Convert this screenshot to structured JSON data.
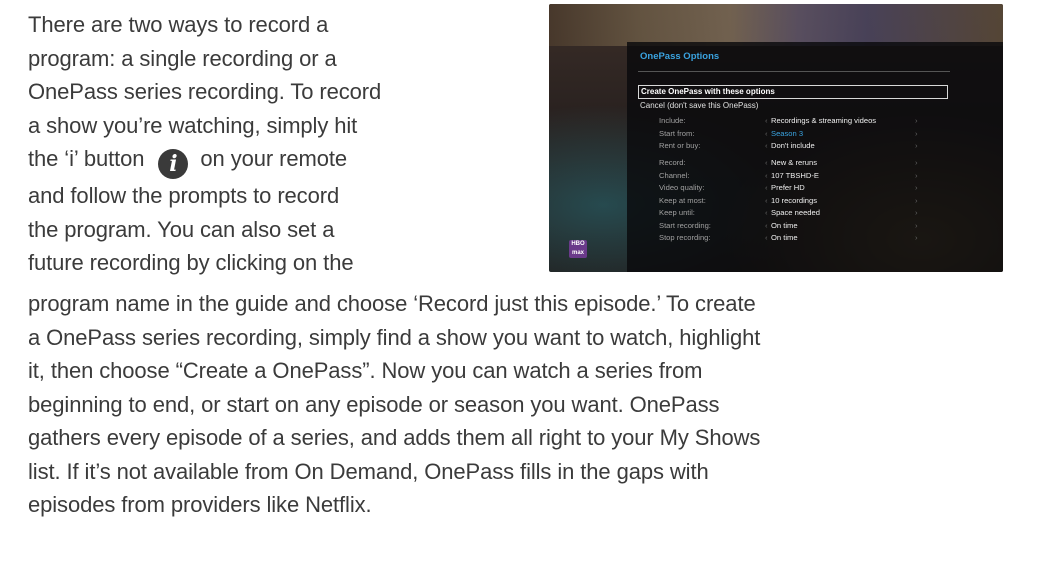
{
  "intro_lines": [
    "There are two ways to record a",
    "program: a single recording or a",
    "OnePass series recording.  To record",
    "a show you’re watching, simply hit"
  ],
  "info_line": {
    "before": "the ‘i’ button",
    "icon_glyph": "i",
    "after": "on your remote"
  },
  "intro_lines_2": [
    "and follow the prompts to record",
    "the program. You can also set a",
    "future recording by clicking on the"
  ],
  "body_lines": [
    "program name in the guide and choose ‘Record just this episode.’ To create",
    "a OnePass series recording, simply find a show you want to watch, highlight",
    "it, then choose “Create a OnePass”. Now you can watch a series from",
    "beginning to end, or start on any episode or season you want. OnePass",
    "gathers every episode of a series, and adds them all right to your My Shows",
    "list. If it’s not available from On Demand, OnePass fills in the gaps with",
    "episodes from providers like Netflix."
  ],
  "tv": {
    "header": "OnePass Options",
    "create": "Create OnePass with these options",
    "cancel": "Cancel (don't save this OnePass)",
    "rows": [
      {
        "label": "Include:",
        "value": "Recordings & streaming videos",
        "hl": false
      },
      {
        "label": "Start from:",
        "value": "Season 3",
        "hl": true
      },
      {
        "label": "Rent or buy:",
        "value": "Don't include",
        "hl": false
      },
      {
        "label": "Record:",
        "value": "New & reruns",
        "hl": false
      },
      {
        "label": "Channel:",
        "value": "107 TBSHD-E",
        "hl": false
      },
      {
        "label": "Video quality:",
        "value": "Prefer HD",
        "hl": false
      },
      {
        "label": "Keep at most:",
        "value": "10 recordings",
        "hl": false
      },
      {
        "label": "Keep until:",
        "value": "Space needed",
        "hl": false
      },
      {
        "label": "Start recording:",
        "value": "On time",
        "hl": false
      },
      {
        "label": "Stop recording:",
        "value": "On time",
        "hl": false
      }
    ],
    "logo": "HBO max"
  },
  "colors": {
    "text": "#3b3b3b",
    "tivo_blue": "#3aa3e0",
    "icon_bg": "#3a3a3a"
  }
}
